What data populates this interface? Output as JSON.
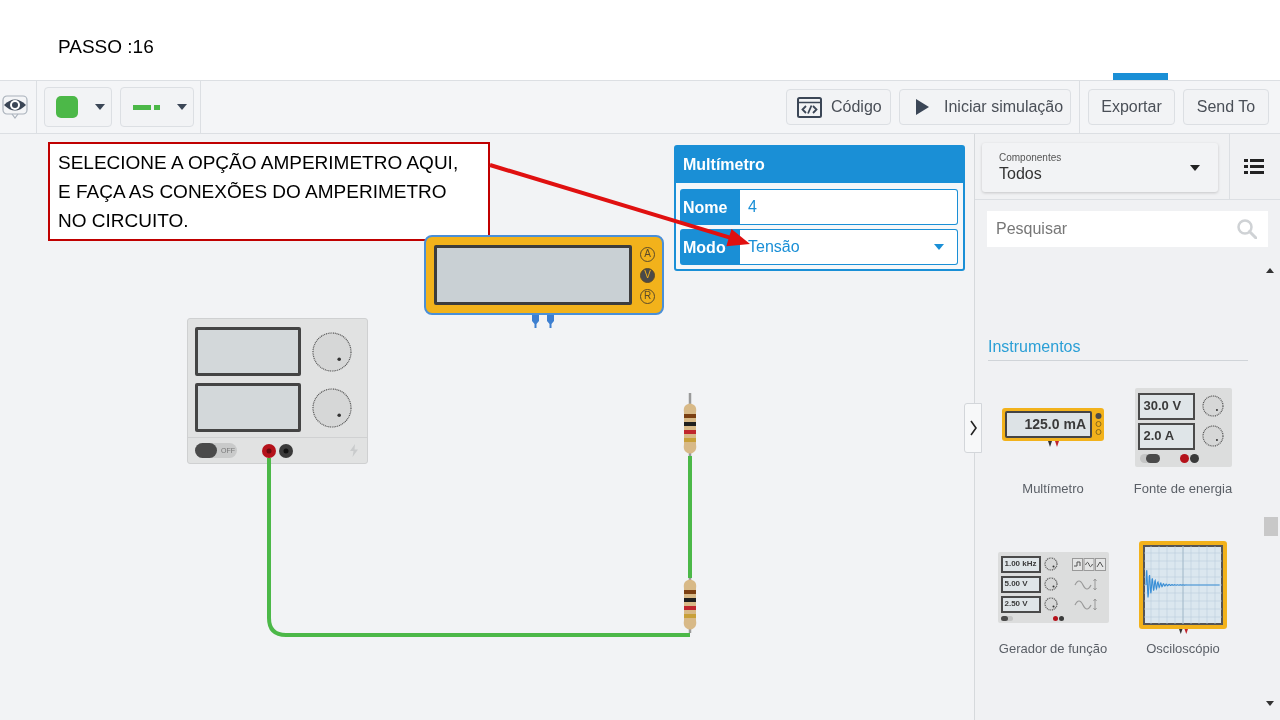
{
  "slide": {
    "title": "PASSO :16"
  },
  "toolbar": {
    "actions": [
      {
        "label": "Código",
        "kind": "code"
      },
      {
        "label": "Iniciar simulação",
        "kind": "play"
      },
      {
        "label": "Exportar",
        "kind": "plain"
      },
      {
        "label": "Send To",
        "kind": "plain"
      }
    ]
  },
  "annotation": {
    "text": "SELECIONE A OPÇÃO AMPERIMETRO AQUI,\nE FAÇA AS CONEXÕES DO AMPERIMETRO\nNO CIRCUITO."
  },
  "inspector": {
    "title": "Multímetro",
    "fields": [
      {
        "label": "Nome",
        "value": "4",
        "kind": "text"
      },
      {
        "label": "Modo",
        "value": "Tensão",
        "kind": "select"
      }
    ]
  },
  "canvas": {
    "multimeter": {
      "modes": [
        {
          "label": "A",
          "selected": false
        },
        {
          "label": "V",
          "selected": true
        },
        {
          "label": "R",
          "selected": false
        }
      ]
    },
    "power_supply": {
      "switch": {
        "label": "OFF",
        "on": false
      }
    }
  },
  "panel": {
    "filter": {
      "label": "Componentes",
      "value": "Todos"
    },
    "search": {
      "placeholder": "Pesquisar"
    },
    "section": {
      "title": "Instrumentos",
      "items": [
        {
          "name": "Multímetro",
          "kind": "multimeter",
          "readings": [
            "125.0 mA"
          ]
        },
        {
          "name": "Fonte de energia",
          "kind": "power_supply",
          "readings": [
            "30.0 V",
            "2.0 A"
          ]
        },
        {
          "name": "Gerador de função",
          "kind": "function_generator",
          "readings": [
            "1.00 kHz",
            "5.00 V",
            "2.50 V"
          ]
        },
        {
          "name": "Osciloscópio",
          "kind": "oscilloscope"
        }
      ]
    }
  }
}
